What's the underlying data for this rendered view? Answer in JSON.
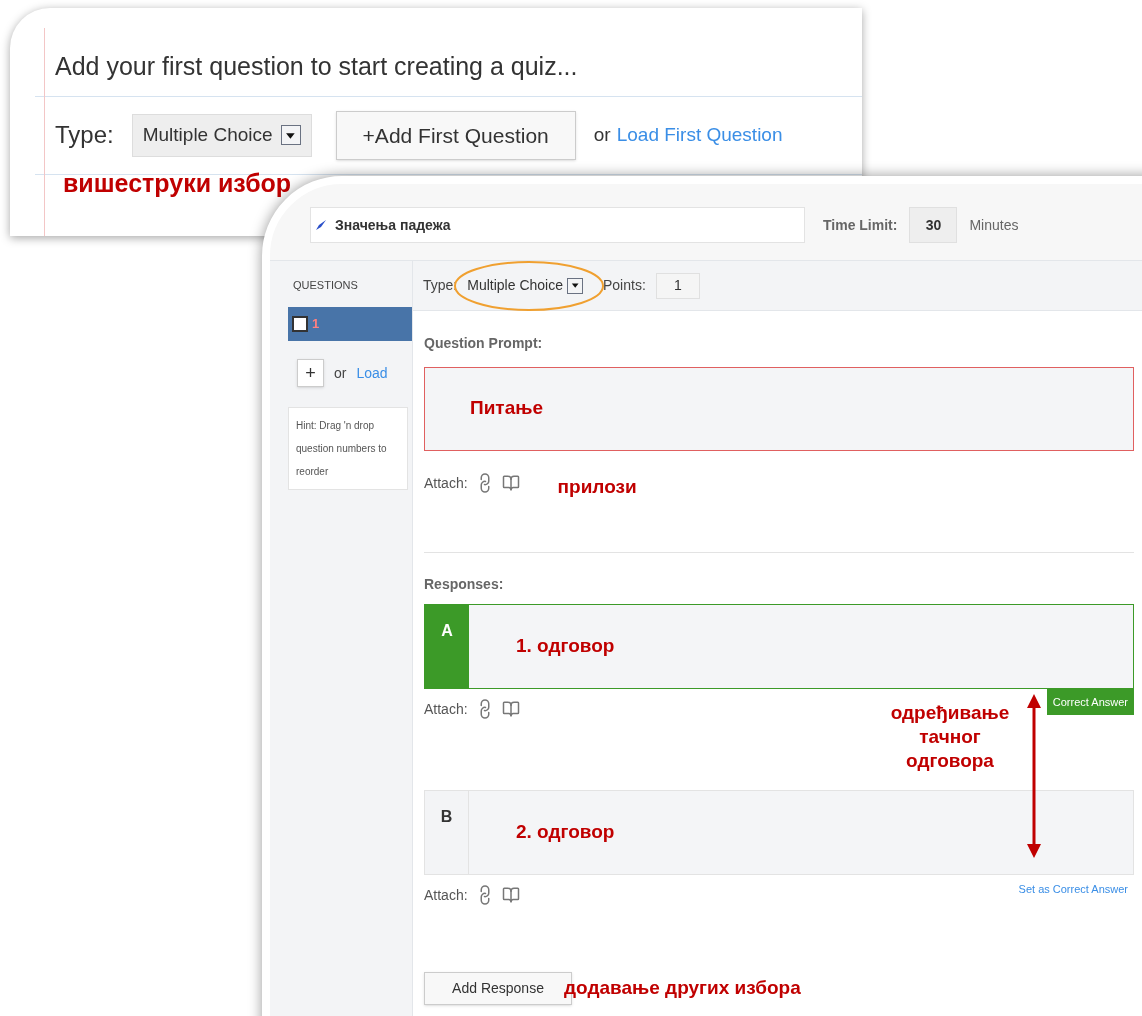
{
  "intro_panel": {
    "heading": "Add your first question to start creating a quiz...",
    "type_label": "Type:",
    "type_select": "Multiple Choice",
    "add_button": "+Add First Question",
    "or_text": "or",
    "load_link": "Load First Question",
    "annotation": "вишеструки избор"
  },
  "editor": {
    "quiz_title": "Значења падежа",
    "time_limit_label": "Time Limit:",
    "time_limit_value": "30",
    "time_unit": "Minutes",
    "sidebar": {
      "heading": "QUESTIONS",
      "questions": [
        {
          "number": "1",
          "selected": true,
          "checked": false
        }
      ],
      "add_button": "+",
      "or_text": "or",
      "load_link": "Load",
      "hint": "Hint: Drag 'n drop question numbers to reorder"
    },
    "type_label": "Type:",
    "type_select": "Multiple Choice",
    "points_label": "Points:",
    "points_value": "1",
    "prompt_label": "Question Prompt:",
    "prompt_text": "Питање",
    "prompt_attach_label": "Attach:",
    "prompt_annotation": "прилози",
    "responses_label": "Responses:",
    "responses": [
      {
        "letter": "A",
        "text": "1. одговор",
        "selected": true,
        "attach_label": "Attach:",
        "action": "Correct Answer"
      },
      {
        "letter": "B",
        "text": "2. одговор",
        "selected": false,
        "attach_label": "Attach:",
        "action": "Set as Correct Answer"
      }
    ],
    "correct_annotation": "одређивање тачног одговора",
    "add_response_button": "Add Response",
    "add_annotation": "додавање других избора"
  }
}
